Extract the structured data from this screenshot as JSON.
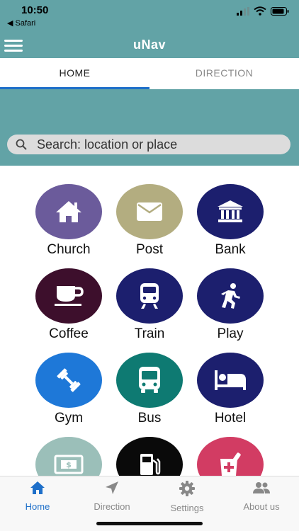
{
  "status_bar": {
    "time": "10:50",
    "back_app": "◀ Safari"
  },
  "header": {
    "title": "uNav"
  },
  "tabs": [
    {
      "label": "HOME",
      "active": true
    },
    {
      "label": "DIRECTION",
      "active": false
    }
  ],
  "search": {
    "placeholder": "Search: location or place"
  },
  "categories": [
    {
      "label": "Church",
      "icon": "home-icon",
      "color": "#6b5b9b"
    },
    {
      "label": "Post",
      "icon": "envelope-icon",
      "color": "#b3ad80"
    },
    {
      "label": "Bank",
      "icon": "bank-icon",
      "color": "#1c1f6e"
    },
    {
      "label": "Coffee",
      "icon": "coffee-cup-icon",
      "color": "#3d0f2c"
    },
    {
      "label": "Train",
      "icon": "train-icon",
      "color": "#1c1f6e"
    },
    {
      "label": "Play",
      "icon": "running-person-icon",
      "color": "#1c1f6e"
    },
    {
      "label": "Gym",
      "icon": "dumbbell-icon",
      "color": "#1e78d8"
    },
    {
      "label": "Bus",
      "icon": "bus-icon",
      "color": "#0e7a72"
    },
    {
      "label": "Hotel",
      "icon": "bed-icon",
      "color": "#1c1f6e"
    },
    {
      "label": "",
      "icon": "money-icon",
      "color": "#9bbfb9"
    },
    {
      "label": "",
      "icon": "fuel-pump-icon",
      "color": "#0a0a0a"
    },
    {
      "label": "",
      "icon": "pharmacy-icon",
      "color": "#d23c63"
    }
  ],
  "bottom_nav": [
    {
      "label": "Home",
      "icon": "home-icon",
      "active": true
    },
    {
      "label": "Direction",
      "icon": "navigation-arrow-icon",
      "active": false
    },
    {
      "label": "Settings",
      "icon": "gear-icon",
      "active": false
    },
    {
      "label": "About us",
      "icon": "people-icon",
      "active": false
    }
  ],
  "colors": {
    "header_bg": "#62a3a6",
    "accent": "#1e6fc9"
  }
}
